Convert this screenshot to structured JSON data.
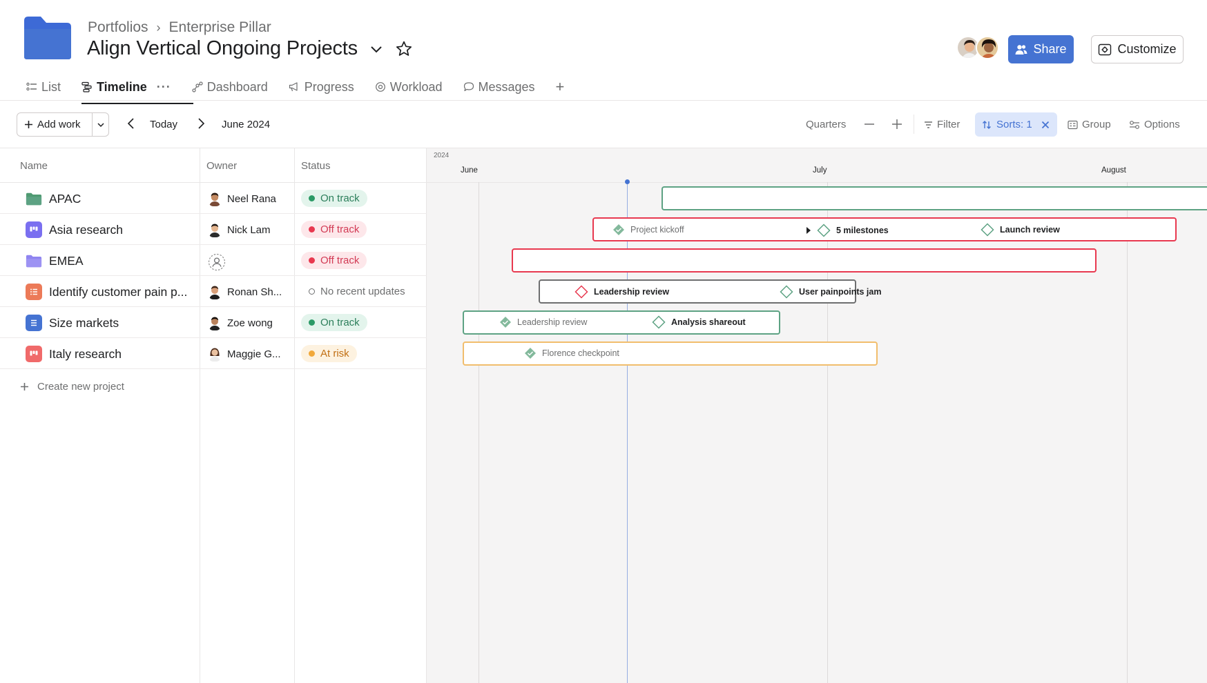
{
  "header": {
    "breadcrumb": [
      "Portfolios",
      "Enterprise Pillar"
    ],
    "title": "Align Vertical Ongoing Projects",
    "share_label": "Share",
    "customize_label": "Customize"
  },
  "tabs": [
    {
      "label": "List",
      "icon": "list-icon"
    },
    {
      "label": "Timeline",
      "icon": "timeline-icon",
      "active": true
    },
    {
      "label": "Dashboard",
      "icon": "dashboard-icon"
    },
    {
      "label": "Progress",
      "icon": "megaphone-icon"
    },
    {
      "label": "Workload",
      "icon": "workload-icon"
    },
    {
      "label": "Messages",
      "icon": "message-icon"
    }
  ],
  "toolbar": {
    "add_work": "Add work",
    "today": "Today",
    "month": "June 2024",
    "quarters": "Quarters",
    "filter": "Filter",
    "sorts": "Sorts: 1",
    "group": "Group",
    "options": "Options"
  },
  "columns": {
    "name": "Name",
    "owner": "Owner",
    "status": "Status"
  },
  "rows": [
    {
      "name": "APAC",
      "icon": "folder-green",
      "owner": "Neel Rana",
      "status": "On track",
      "status_type": "green"
    },
    {
      "name": "Asia research",
      "icon": "board-purple",
      "owner": "Nick Lam",
      "status": "Off track",
      "status_type": "red"
    },
    {
      "name": "EMEA",
      "icon": "folder-purple",
      "owner": "",
      "status": "Off track",
      "status_type": "red"
    },
    {
      "name": "Identify customer pain p...",
      "icon": "list-orange",
      "owner": "Ronan Sh...",
      "status": "No recent updates",
      "status_type": "none"
    },
    {
      "name": "Size markets",
      "icon": "list-blue",
      "owner": "Zoe wong",
      "status": "On track",
      "status_type": "green"
    },
    {
      "name": "Italy research",
      "icon": "board-red",
      "owner": "Maggie G...",
      "status": "At risk",
      "status_type": "amber"
    }
  ],
  "create_project": "Create new project",
  "timeline": {
    "year": "2024",
    "months": [
      "June",
      "July",
      "August"
    ],
    "milestones": {
      "asia": [
        "Project kickoff",
        "5 milestones",
        "Launch review"
      ],
      "identify": [
        "Leadership review",
        "User painpoints jam"
      ],
      "size": [
        "Leadership review",
        "Analysis shareout"
      ],
      "italy": [
        "Florence checkpoint"
      ]
    }
  },
  "colors": {
    "accent": "#4573d2",
    "green": "#5da283",
    "red": "#e8384f",
    "amber": "#f1bd6c"
  }
}
